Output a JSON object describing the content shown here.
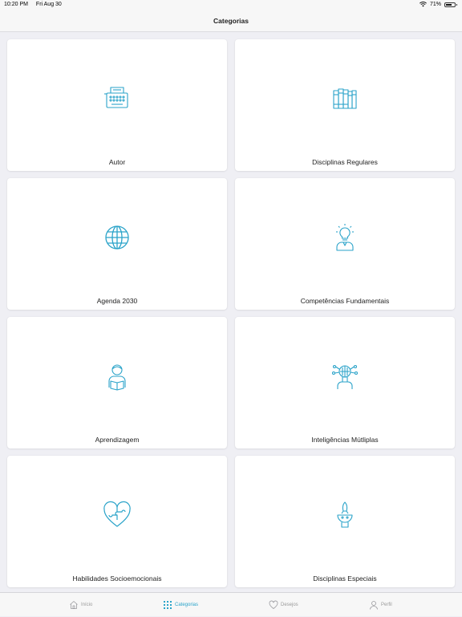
{
  "status": {
    "time": "10:20 PM",
    "date": "Fri Aug 30",
    "battery": "71%",
    "battery_level": 0.71
  },
  "header": {
    "title": "Categorias"
  },
  "categories": [
    {
      "label": "Autor",
      "icon": "typewriter-icon"
    },
    {
      "label": "Disciplinas Regulares",
      "icon": "books-icon"
    },
    {
      "label": "Agenda 2030",
      "icon": "globe-icon"
    },
    {
      "label": "Competências Fundamentais",
      "icon": "lightbulb-person-icon"
    },
    {
      "label": "Aprendizagem",
      "icon": "reading-person-icon"
    },
    {
      "label": "Inteligências Mútliplas",
      "icon": "brain-network-icon"
    },
    {
      "label": "Habilidades Socioemocionais",
      "icon": "heart-puzzle-icon"
    },
    {
      "label": "Disciplinas Especiais",
      "icon": "rocket-head-icon"
    }
  ],
  "tabs": [
    {
      "label": "Início",
      "icon": "home-icon",
      "active": false
    },
    {
      "label": "Categorias",
      "icon": "grid-icon",
      "active": true
    },
    {
      "label": "Desejos",
      "icon": "heart-icon",
      "active": false
    },
    {
      "label": "Perfil",
      "icon": "person-icon",
      "active": false
    }
  ],
  "colors": {
    "accent": "#2aa3c9",
    "background": "#efeff4",
    "card": "#ffffff"
  }
}
